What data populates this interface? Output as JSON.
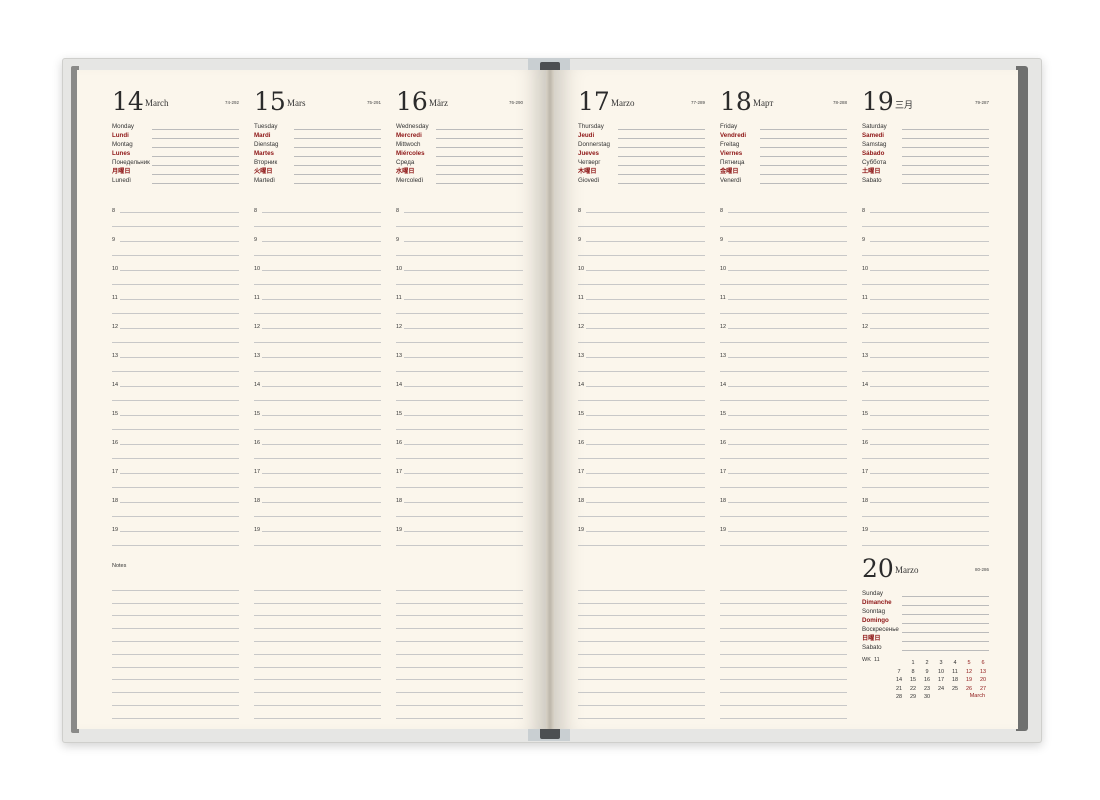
{
  "hours": [
    "8",
    "9",
    "10",
    "11",
    "12",
    "13",
    "14",
    "15",
    "16",
    "17",
    "18",
    "19"
  ],
  "notes_label": "Notes",
  "days": [
    {
      "num": "14",
      "month": "March",
      "count": "74-292",
      "names": [
        "Monday",
        "Lundi",
        "Montag",
        "Lunes",
        "Понедельник",
        "月曜日",
        "Lunedì"
      ]
    },
    {
      "num": "15",
      "month": "Mars",
      "count": "75-291",
      "names": [
        "Tuesday",
        "Mardi",
        "Dienstag",
        "Martes",
        "Вторник",
        "火曜日",
        "Martedì"
      ]
    },
    {
      "num": "16",
      "month": "März",
      "count": "76-290",
      "names": [
        "Wednesday",
        "Mercredi",
        "Mittwoch",
        "Miércoles",
        "Среда",
        "水曜日",
        "Mercoledì"
      ]
    },
    {
      "num": "17",
      "month": "Marzo",
      "count": "77-289",
      "names": [
        "Thursday",
        "Jeudi",
        "Donnerstag",
        "Jueves",
        "Четверг",
        "木曜日",
        "Giovedì"
      ]
    },
    {
      "num": "18",
      "month": "Март",
      "count": "78-288",
      "names": [
        "Friday",
        "Vendredi",
        "Freitag",
        "Viernes",
        "Пятница",
        "金曜日",
        "Venerdì"
      ]
    },
    {
      "num": "19",
      "month": "三月",
      "count": "79-287",
      "names": [
        "Saturday",
        "Samedi",
        "Samstag",
        "Sábado",
        "Суббота",
        "土曜日",
        "Sabato"
      ]
    }
  ],
  "sunday": {
    "num": "20",
    "month": "Marzo",
    "count": "80-286",
    "names": [
      "Sunday",
      "Dimanche",
      "Sonntag",
      "Domingo",
      "Воскресенье",
      "日曜日",
      "Sabato"
    ]
  },
  "mini_calendar": {
    "week_label": "WK",
    "week_number": "11",
    "month": "March",
    "rows": [
      [
        "",
        "",
        "1",
        "2",
        "3",
        "4",
        "5",
        "6"
      ],
      [
        "",
        "7",
        "8",
        "9",
        "10",
        "11",
        "12",
        "13"
      ],
      [
        "",
        "14",
        "15",
        "16",
        "17",
        "18",
        "19",
        "20"
      ],
      [
        "",
        "21",
        "22",
        "23",
        "24",
        "25",
        "26",
        "27"
      ],
      [
        "",
        "28",
        "29",
        "30",
        "",
        "",
        "",
        ""
      ]
    ]
  }
}
